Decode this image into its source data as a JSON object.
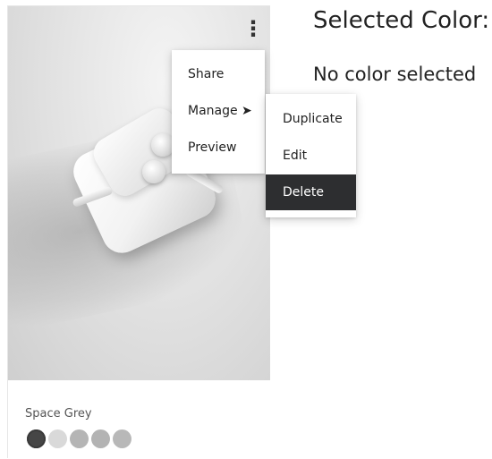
{
  "card": {
    "color_label": "Space Grey",
    "more_button_icon": "more-vertical-icon",
    "more_button_glyph": "⋮",
    "swatches": [
      {
        "name": "space-grey",
        "color": "#464646",
        "selected": true
      },
      {
        "name": "light-grey",
        "color": "#d9d9d9",
        "selected": false
      },
      {
        "name": "grey",
        "color": "#b5b5b5",
        "selected": false
      },
      {
        "name": "grey-2",
        "color": "#b3b3b3",
        "selected": false
      },
      {
        "name": "grey-3",
        "color": "#b8b8b8",
        "selected": false
      }
    ]
  },
  "menu": {
    "items": [
      "Share",
      "Manage ➤",
      "Preview"
    ],
    "submenu": {
      "items": [
        "Duplicate",
        "Edit",
        "Delete"
      ],
      "highlighted": "Delete"
    }
  },
  "panel": {
    "title": "Selected Color:",
    "status": "No color selected"
  }
}
